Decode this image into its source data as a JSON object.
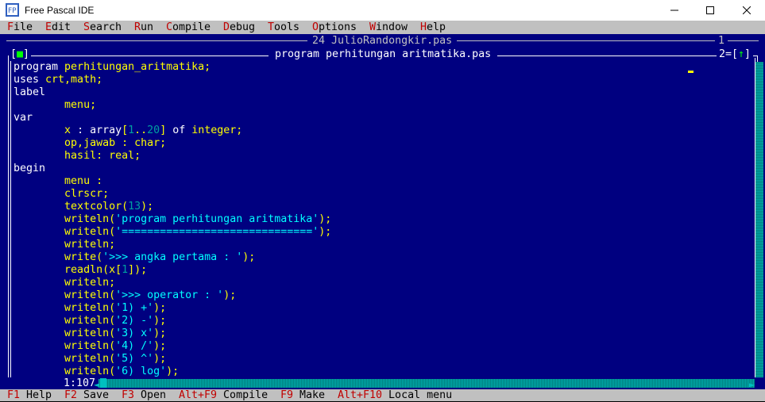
{
  "window": {
    "title": "Free Pascal IDE",
    "icon": "free-pascal-icon"
  },
  "menu": {
    "items": [
      {
        "hot": "F",
        "rest": "ile"
      },
      {
        "hot": "E",
        "rest": "dit"
      },
      {
        "hot": "S",
        "rest": "earch"
      },
      {
        "hot": "R",
        "rest": "un"
      },
      {
        "hot": "C",
        "rest": "ompile"
      },
      {
        "hot": "D",
        "rest": "ebug"
      },
      {
        "hot": "T",
        "rest": "ools"
      },
      {
        "hot": "O",
        "rest": "ptions"
      },
      {
        "hot": "W",
        "rest": "indow"
      },
      {
        "hot": "H",
        "rest": "elp"
      }
    ]
  },
  "background_window": {
    "title": "24 JulioRandongkir.pas",
    "number": "1"
  },
  "editor": {
    "close_box": "[",
    "close_box_mark": "■",
    "close_box_end": "]",
    "title": "program perhitungan aritmatika.pas",
    "number_prefix": "2=[",
    "zoom_arrow": "↑",
    "number_suffix": "]",
    "cursor_position": "1:107",
    "code": [
      [
        [
          "kw",
          "program "
        ],
        [
          "id",
          "perhitungan_aritmatika;"
        ]
      ],
      [
        [
          "kw",
          "uses "
        ],
        [
          "id",
          "crt,math;"
        ]
      ],
      [
        [
          "kw",
          "label"
        ]
      ],
      [
        [
          "kw",
          "        "
        ],
        [
          "id",
          "menu;"
        ]
      ],
      [
        [
          "kw",
          "var"
        ]
      ],
      [
        [
          "kw",
          "        "
        ],
        [
          "id",
          "x"
        ],
        [
          "kw",
          " : "
        ],
        [
          "kw",
          "array"
        ],
        [
          "id",
          "["
        ],
        [
          "num",
          "1"
        ],
        [
          "id",
          ".."
        ],
        [
          "num",
          "20"
        ],
        [
          "id",
          "]"
        ],
        [
          "kw",
          " of "
        ],
        [
          "id",
          "integer;"
        ]
      ],
      [
        [
          "kw",
          "        "
        ],
        [
          "id",
          "op,jawab : char;"
        ]
      ],
      [
        [
          "kw",
          "        "
        ],
        [
          "id",
          "hasil: real;"
        ]
      ],
      [
        [
          "kw",
          "begin"
        ]
      ],
      [
        [
          "kw",
          "        "
        ],
        [
          "id",
          "menu :"
        ]
      ],
      [
        [
          "kw",
          "        "
        ],
        [
          "id",
          "clrscr;"
        ]
      ],
      [
        [
          "kw",
          "        "
        ],
        [
          "id",
          "textcolor("
        ],
        [
          "num",
          "13"
        ],
        [
          "id",
          ");"
        ]
      ],
      [
        [
          "kw",
          "        "
        ],
        [
          "id",
          "writeln("
        ],
        [
          "str",
          "'program perhitungan aritmatika'"
        ],
        [
          "id",
          ");"
        ]
      ],
      [
        [
          "kw",
          "        "
        ],
        [
          "id",
          "writeln("
        ],
        [
          "str",
          "'=============================='"
        ],
        [
          "id",
          ");"
        ]
      ],
      [
        [
          "kw",
          "        "
        ],
        [
          "id",
          "writeln;"
        ]
      ],
      [
        [
          "kw",
          "        "
        ],
        [
          "id",
          "write("
        ],
        [
          "str",
          "'>>> angka pertama : '"
        ],
        [
          "id",
          ");"
        ]
      ],
      [
        [
          "kw",
          "        "
        ],
        [
          "id",
          "readln(x["
        ],
        [
          "num",
          "1"
        ],
        [
          "id",
          "]);"
        ]
      ],
      [
        [
          "kw",
          "        "
        ],
        [
          "id",
          "writeln;"
        ]
      ],
      [
        [
          "kw",
          "        "
        ],
        [
          "id",
          "writeln("
        ],
        [
          "str",
          "'>>> operator : '"
        ],
        [
          "id",
          ");"
        ]
      ],
      [
        [
          "kw",
          "        "
        ],
        [
          "id",
          "writeln("
        ],
        [
          "str",
          "'1) +'"
        ],
        [
          "id",
          ");"
        ]
      ],
      [
        [
          "kw",
          "        "
        ],
        [
          "id",
          "writeln("
        ],
        [
          "str",
          "'2) -'"
        ],
        [
          "id",
          ");"
        ]
      ],
      [
        [
          "kw",
          "        "
        ],
        [
          "id",
          "writeln("
        ],
        [
          "str",
          "'3) x'"
        ],
        [
          "id",
          ");"
        ]
      ],
      [
        [
          "kw",
          "        "
        ],
        [
          "id",
          "writeln("
        ],
        [
          "str",
          "'4) /'"
        ],
        [
          "id",
          ");"
        ]
      ],
      [
        [
          "kw",
          "        "
        ],
        [
          "id",
          "writeln("
        ],
        [
          "str",
          "'5) ^'"
        ],
        [
          "id",
          ");"
        ]
      ],
      [
        [
          "kw",
          "        "
        ],
        [
          "id",
          "writeln("
        ],
        [
          "str",
          "'6) log'"
        ],
        [
          "id",
          ");"
        ]
      ]
    ]
  },
  "function_keys": [
    {
      "key": "F1",
      "label": " Help"
    },
    {
      "key": "F2",
      "label": " Save"
    },
    {
      "key": "F3",
      "label": " Open"
    },
    {
      "key": "Alt+F9",
      "label": " Compile"
    },
    {
      "key": "F9",
      "label": " Make"
    },
    {
      "key": "Alt+F10",
      "label": " Local menu"
    }
  ],
  "colors": {
    "editor_bg": "#000080",
    "menu_bg": "#c0c0c0",
    "hotkey": "#c00000",
    "identifier": "#ffff00",
    "string": "#00ffff",
    "number": "#00a0a0"
  }
}
